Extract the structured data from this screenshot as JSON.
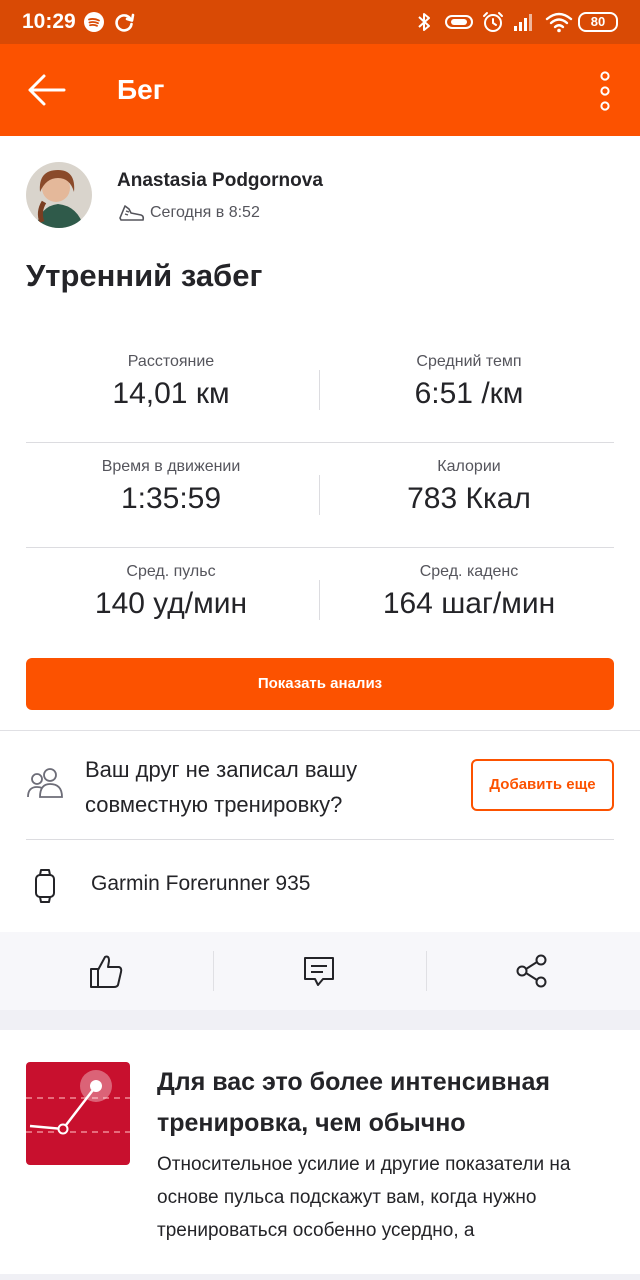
{
  "status_bar": {
    "time": "10:29",
    "battery": "80"
  },
  "app_bar": {
    "title": "Бег"
  },
  "athlete": {
    "name": "Anastasia Podgornova",
    "timestamp": "Сегодня в 8:52"
  },
  "activity": {
    "title": "Утренний забег"
  },
  "stats": [
    {
      "label": "Расстояние",
      "value": "14,01 км"
    },
    {
      "label": "Средний темп",
      "value": "6:51 /км"
    },
    {
      "label": "Время в движении",
      "value": "1:35:59"
    },
    {
      "label": "Калории",
      "value": "783 Ккал"
    },
    {
      "label": "Сред. пульс",
      "value": "140 уд/мин"
    },
    {
      "label": "Сред. каденс",
      "value": "164 шаг/мин"
    }
  ],
  "analysis_button": "Показать анализ",
  "friends": {
    "text": "Ваш друг не записал вашу совместную тренировку?",
    "button": "Добавить еще"
  },
  "device": "Garmin Forerunner 935",
  "insight": {
    "title": "Для вас это более интенсивная тренировка, чем обычно",
    "body": "Относительное усилие и другие показатели на основе пульса подскажут вам, когда нужно тренироваться особенно усердно, а"
  },
  "colors": {
    "accent": "#fc5200",
    "status_bar": "#d94a05",
    "insight_tile": "#c8102e"
  },
  "icons": [
    "spotify-icon",
    "sync-icon",
    "bluetooth-icon",
    "vibrate-icon",
    "alarm-icon",
    "signal-icon",
    "wifi-icon",
    "back-arrow-icon",
    "more-vert-icon",
    "shoe-icon",
    "friends-icon",
    "watch-icon",
    "thumbs-up-icon",
    "comment-icon",
    "share-icon"
  ]
}
